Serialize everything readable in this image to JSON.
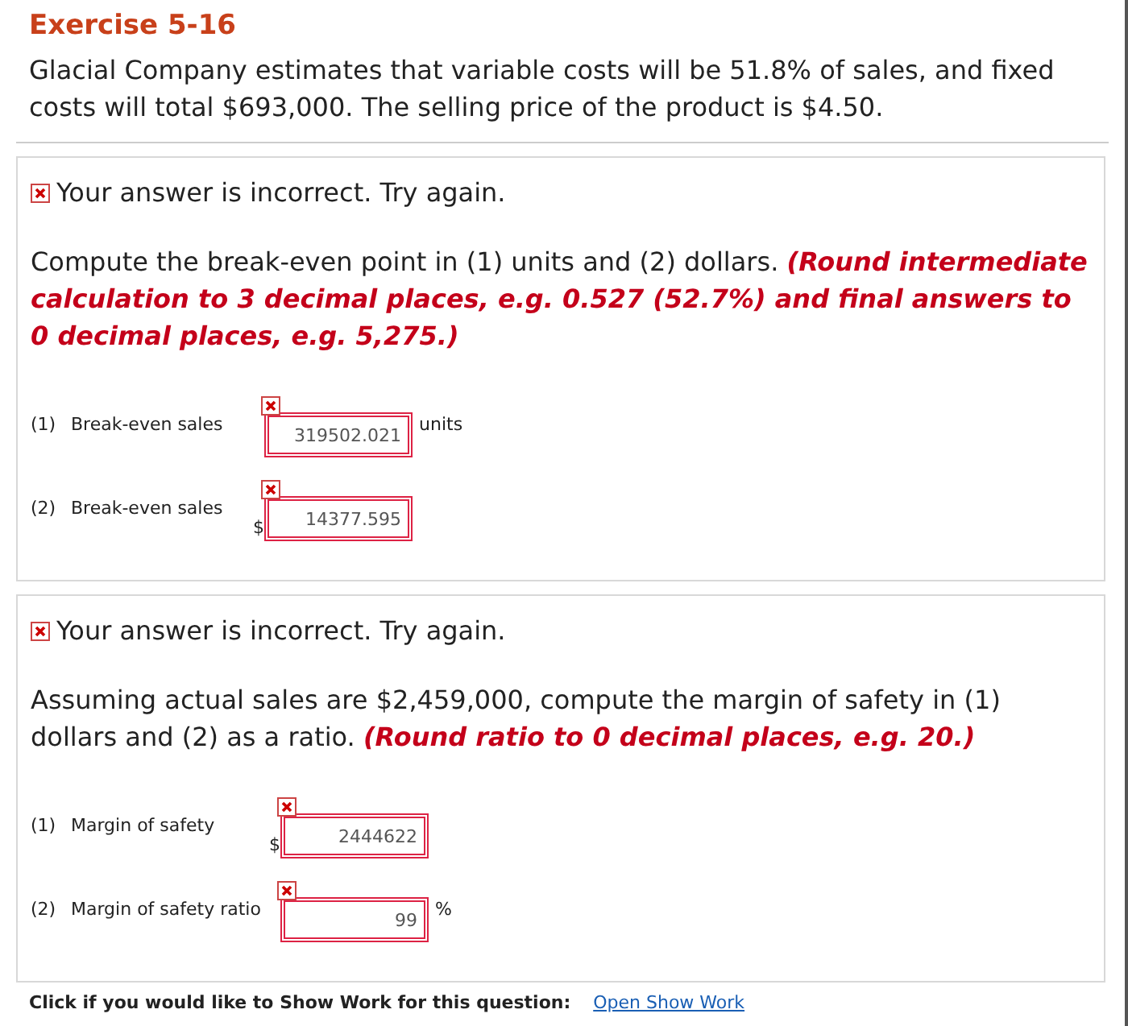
{
  "title": "Exercise 5-16",
  "problem": "Glacial Company estimates that variable costs will be 51.8% of sales, and fixed costs will total $693,000. The selling price of the product is $4.50.",
  "parts": [
    {
      "feedback": {
        "correct": false,
        "text": "Your answer is incorrect.  Try again."
      },
      "question": "Compute the break-even point in (1) units and (2) dollars. **(Round intermediate calculation to 3 decimal places, e.g. 0.527 (52.7%) and final answers to 0 decimal places, e.g. 5,275.)**",
      "answers": [
        {
          "number": "(1)",
          "label": "Break-even sales",
          "value": "319502.021",
          "suffix": "units",
          "correct": false
        },
        {
          "number": "(2)",
          "label": "Break-even sales",
          "prefix": "$",
          "value": "14377.595",
          "correct": false
        }
      ]
    },
    {
      "feedback": {
        "correct": false,
        "text": "Your answer is incorrect.  Try again."
      },
      "question": "Assuming actual sales are $2,459,000, compute the margin of safety in (1) dollars and (2) as a ratio. **(Round ratio to 0 decimal places, e.g. 20.)**",
      "answers": [
        {
          "number": "(1)",
          "label": "Margin of safety",
          "prefix": "$",
          "value": "2444622",
          "correct": false
        },
        {
          "number": "(2)",
          "label": "Margin of safety ratio",
          "value": "99",
          "suffix": "%",
          "correct": false
        }
      ]
    }
  ],
  "show_work": {
    "text": "Click if you would like to Show Work for this question:",
    "link": "Open Show Work"
  }
}
